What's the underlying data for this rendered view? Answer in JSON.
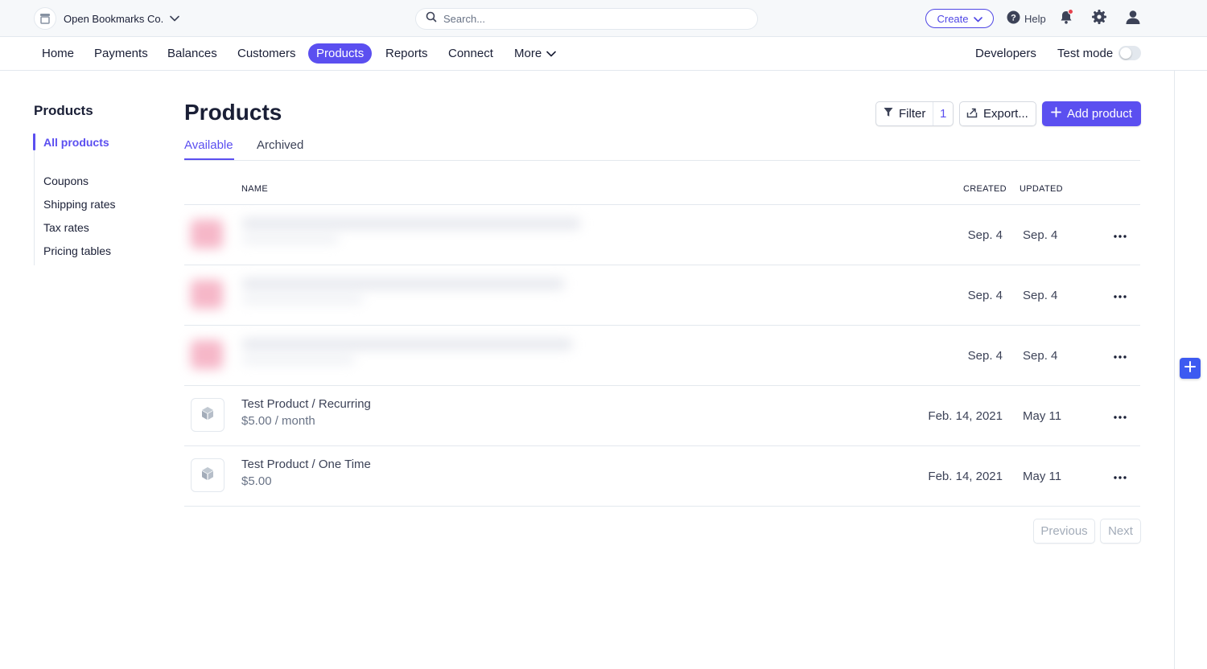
{
  "topbar": {
    "account_name": "Open Bookmarks Co.",
    "search_placeholder": "Search...",
    "create_label": "Create",
    "help_label": "Help",
    "notification_dot_color": "#e5424d"
  },
  "nav": {
    "items": [
      {
        "label": "Home"
      },
      {
        "label": "Payments"
      },
      {
        "label": "Balances"
      },
      {
        "label": "Customers"
      },
      {
        "label": "Products",
        "active": true
      },
      {
        "label": "Reports"
      },
      {
        "label": "Connect"
      },
      {
        "label": "More"
      }
    ],
    "developers_label": "Developers",
    "test_mode_label": "Test mode",
    "test_mode_on": false
  },
  "sidebar": {
    "title": "Products",
    "items": [
      {
        "label": "All products",
        "active": true
      },
      {
        "label": "Coupons"
      },
      {
        "label": "Shipping rates"
      },
      {
        "label": "Tax rates"
      },
      {
        "label": "Pricing tables"
      }
    ]
  },
  "main": {
    "title": "Products",
    "filter_label": "Filter",
    "filter_count": "1",
    "export_label": "Export...",
    "add_label": "Add product",
    "tabs": [
      {
        "label": "Available",
        "active": true
      },
      {
        "label": "Archived"
      }
    ],
    "columns": {
      "name": "NAME",
      "created": "CREATED",
      "updated": "UPDATED"
    },
    "rows": [
      {
        "name": "",
        "price": "",
        "created": "Sep. 4",
        "updated": "Sep. 4",
        "blurred": true
      },
      {
        "name": "",
        "price": "",
        "created": "Sep. 4",
        "updated": "Sep. 4",
        "blurred": true
      },
      {
        "name": "",
        "price": "",
        "created": "Sep. 4",
        "updated": "Sep. 4",
        "blurred": true
      },
      {
        "name": "Test Product / Recurring",
        "price": "$5.00 / month",
        "created": "Feb. 14, 2021",
        "updated": "May 11",
        "blurred": false
      },
      {
        "name": "Test Product / One Time",
        "price": "$5.00",
        "created": "Feb. 14, 2021",
        "updated": "May 11",
        "blurred": false
      }
    ],
    "pagination": {
      "previous_label": "Previous",
      "next_label": "Next"
    }
  },
  "colors": {
    "accent": "#5b4ff0",
    "border": "#e3e8ee",
    "topbar_bg": "#f6f8fa",
    "fab": "#3d5af1"
  }
}
